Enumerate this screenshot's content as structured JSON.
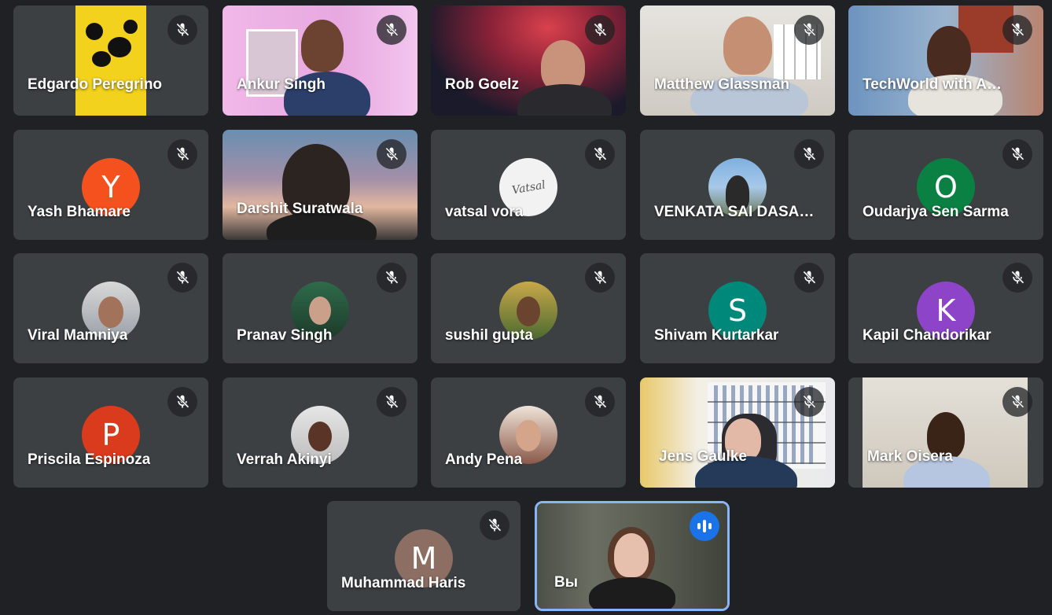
{
  "participants": [
    {
      "name": "Edgardo Peregrino",
      "mic": "muted",
      "type": "video"
    },
    {
      "name": "Ankur Singh",
      "mic": "muted",
      "type": "video"
    },
    {
      "name": "Rob Goelz",
      "mic": "muted",
      "type": "video"
    },
    {
      "name": "Matthew Glassman",
      "mic": "muted",
      "type": "video"
    },
    {
      "name": "TechWorld with A…",
      "mic": "muted",
      "type": "video"
    },
    {
      "name": "Yash Bhamare",
      "initial": "Y",
      "avatar_color": "#f4511e",
      "mic": "muted",
      "type": "avatar"
    },
    {
      "name": "Darshit Suratwala",
      "mic": "muted",
      "type": "video"
    },
    {
      "name": "vatsal vora",
      "mic": "muted",
      "type": "photo"
    },
    {
      "name": "VENKATA SAI DASA…",
      "mic": "muted",
      "type": "photo"
    },
    {
      "name": "Oudarjya Sen Sarma",
      "initial": "O",
      "avatar_color": "#0b8043",
      "mic": "muted",
      "type": "avatar"
    },
    {
      "name": "Viral Mamniya",
      "mic": "muted",
      "type": "photo"
    },
    {
      "name": "Pranav Singh",
      "mic": "muted",
      "type": "photo"
    },
    {
      "name": "sushil gupta",
      "mic": "muted",
      "type": "photo"
    },
    {
      "name": "Shivam Kurtarkar",
      "initial": "S",
      "avatar_color": "#00897b",
      "mic": "muted",
      "type": "avatar"
    },
    {
      "name": "Kapil Chandorikar",
      "initial": "K",
      "avatar_color": "#8e44c8",
      "mic": "muted",
      "type": "avatar"
    },
    {
      "name": "Priscila Espinoza",
      "initial": "P",
      "avatar_color": "#d93b1c",
      "mic": "muted",
      "type": "avatar"
    },
    {
      "name": "Verrah Akinyi",
      "mic": "muted",
      "type": "photo"
    },
    {
      "name": "Andy Pena",
      "mic": "muted",
      "type": "photo"
    },
    {
      "name": "Jens Gaulke",
      "mic": "muted",
      "type": "video"
    },
    {
      "name": "Mark Oisera",
      "mic": "muted",
      "type": "video"
    },
    {
      "name": "Muhammad Haris",
      "initial": "M",
      "avatar_color": "#8d6e63",
      "mic": "muted",
      "type": "avatar"
    }
  ],
  "self": {
    "name": "Вы",
    "mic": "speaking"
  },
  "colors": {
    "background": "#202124",
    "tile": "#3c4043",
    "active_border": "#8ab4f8",
    "speaking": "#1a73e8"
  },
  "icons": {
    "mic_muted": "mic-off-icon",
    "speaking": "audio-level-icon"
  }
}
